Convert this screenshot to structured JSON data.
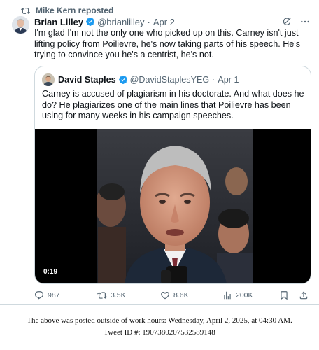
{
  "repost": {
    "label": "Mike Kern reposted",
    "icon": "repost-icon"
  },
  "tweet": {
    "author_name": "Brian Lilley",
    "handle": "@brianlilley",
    "separator": "·",
    "date": "Apr 2",
    "text": "I'm glad I'm not the only one who picked up on this. Carney isn't just lifting policy from Poilievre, he's now taking parts of his speech. He's trying to convince you he's a centrist, he's not."
  },
  "quote": {
    "author_name": "David Staples",
    "handle": "@DavidStaplesYEG",
    "separator": "·",
    "date": "Apr 1",
    "text": "Carney is accused of plagiarism in his doctorate. And what does he do? He plagiarizes one of the main lines that Poilievre has been using for many weeks in his campaign speeches.",
    "video_time": "0:19"
  },
  "actions": {
    "replies": "987",
    "reposts": "3.5K",
    "likes": "8.6K",
    "views": "200K"
  },
  "caption": {
    "line1": "The above was posted outside of work hours: Wednesday, April 2, 2025, at 04:30 AM.",
    "line2": "Tweet ID #: 1907380207532589148"
  },
  "colors": {
    "verified": "#1d9bf0",
    "secondary_text": "#536471",
    "border": "#cfd9de"
  }
}
